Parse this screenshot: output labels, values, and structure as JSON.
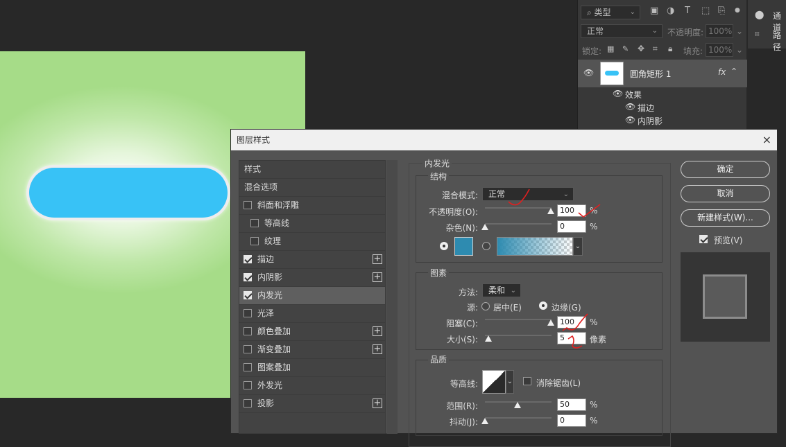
{
  "colors": {
    "pill": "#38c2f6",
    "canvas_bg": "#a6dc88",
    "swatch": "#2e8bb0",
    "annotation": "#e02020"
  },
  "layers_panel": {
    "filter_select": "类型",
    "blend_select": "正常",
    "opacity_label": "不透明度:",
    "opacity_value": "100%",
    "lock_label": "锁定:",
    "fill_label": "填充:",
    "fill_value": "100%",
    "layer_name": "圆角矩形 1",
    "fx": "fx",
    "effects_label": "效果",
    "effect_items": [
      "描边",
      "内阴影"
    ],
    "channels_label": "通道",
    "paths_label": "路径"
  },
  "dialog": {
    "title": "图层样式",
    "close": "×",
    "style_list": [
      {
        "label": "样式"
      },
      {
        "label": "混合选项"
      },
      {
        "label": "斜面和浮雕",
        "checked": false
      },
      {
        "label": "等高线",
        "checked": false
      },
      {
        "label": "纹理",
        "checked": false
      },
      {
        "label": "描边",
        "checked": true,
        "plus": "+"
      },
      {
        "label": "内阴影",
        "checked": true,
        "plus": "+"
      },
      {
        "label": "内发光",
        "checked": true
      },
      {
        "label": "光泽",
        "checked": false
      },
      {
        "label": "颜色叠加",
        "checked": false,
        "plus": "+"
      },
      {
        "label": "渐变叠加",
        "checked": false,
        "plus": "+"
      },
      {
        "label": "图案叠加",
        "checked": false
      },
      {
        "label": "外发光",
        "checked": false
      },
      {
        "label": "投影",
        "checked": false,
        "plus": "+"
      }
    ],
    "section_title": "内发光",
    "structure": {
      "title": "结构",
      "blend_mode_label": "混合模式:",
      "blend_mode_value": "正常",
      "opacity_label": "不透明度(O):",
      "opacity_value": "100",
      "opacity_unit": "%",
      "noise_label": "杂色(N):",
      "noise_value": "0",
      "noise_unit": "%"
    },
    "elements": {
      "title": "图素",
      "method_label": "方法:",
      "method_value": "柔和",
      "source_label": "源:",
      "source_center": "居中(E)",
      "source_edge": "边缘(G)",
      "choke_label": "阻塞(C):",
      "choke_value": "100",
      "choke_unit": "%",
      "size_label": "大小(S):",
      "size_value": "5",
      "size_unit": "像素"
    },
    "quality": {
      "title": "品质",
      "contour_label": "等高线:",
      "antialias_label": "消除锯齿(L)",
      "range_label": "范围(R):",
      "range_value": "50",
      "range_unit": "%",
      "jitter_label": "抖动(J):",
      "jitter_value": "0",
      "jitter_unit": "%"
    },
    "buttons": {
      "ok": "确定",
      "cancel": "取消",
      "new_style": "新建样式(W)...",
      "preview": "预览(V)"
    }
  }
}
